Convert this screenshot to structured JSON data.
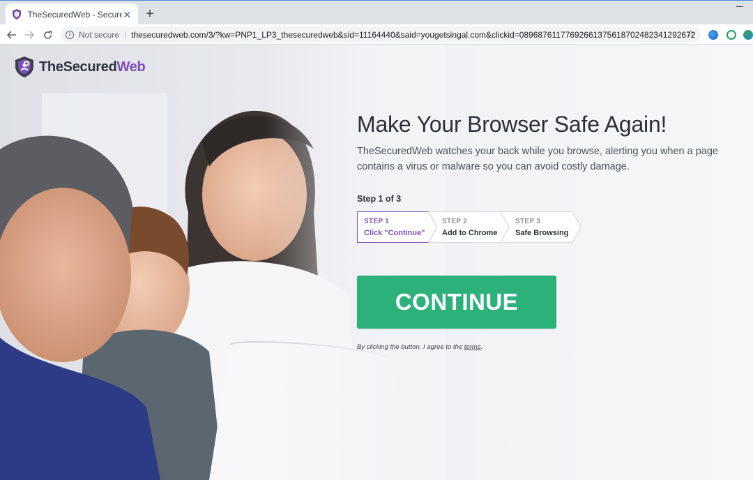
{
  "browser": {
    "tab_title": "TheSecuredWeb - Secure Your Br",
    "tab_close": "✕",
    "new_tab": "+",
    "not_secure": "Not secure",
    "url": "thesecuredweb.com/3/?kw=PNP1_LP3_thesecuredweb&sid=11164440&said=yougetsingal.com&clickid=08968761177692661375618702482341292672",
    "icons": [
      "back-icon",
      "forward-icon",
      "reload-icon",
      "info-icon",
      "star-icon",
      "extension-icons"
    ]
  },
  "logo": {
    "prefix": "TheSecured",
    "accent": "Web"
  },
  "hero": {
    "headline": "Make Your Browser Safe Again!",
    "subhead": "TheSecuredWeb watches your back while you browse, alerting you when a page contains a virus or malware so you can avoid costly damage."
  },
  "steps": {
    "counter": "Step 1 of 3",
    "items": [
      {
        "tag": "STEP 1",
        "label": "Click \"Continue\"",
        "active": true
      },
      {
        "tag": "STEP 2",
        "label": "Add to Chrome",
        "active": false
      },
      {
        "tag": "STEP 3",
        "label": "Safe Browsing",
        "active": false
      }
    ]
  },
  "cta": {
    "label": "CONTINUE",
    "terms_prefix": "By clicking the button, I agree to the ",
    "terms_link": "terms",
    "terms_suffix": "."
  },
  "colors": {
    "accent_purple": "#7d4fb6",
    "cta_green": "#2db17a",
    "text_dark": "#2b2f36"
  }
}
